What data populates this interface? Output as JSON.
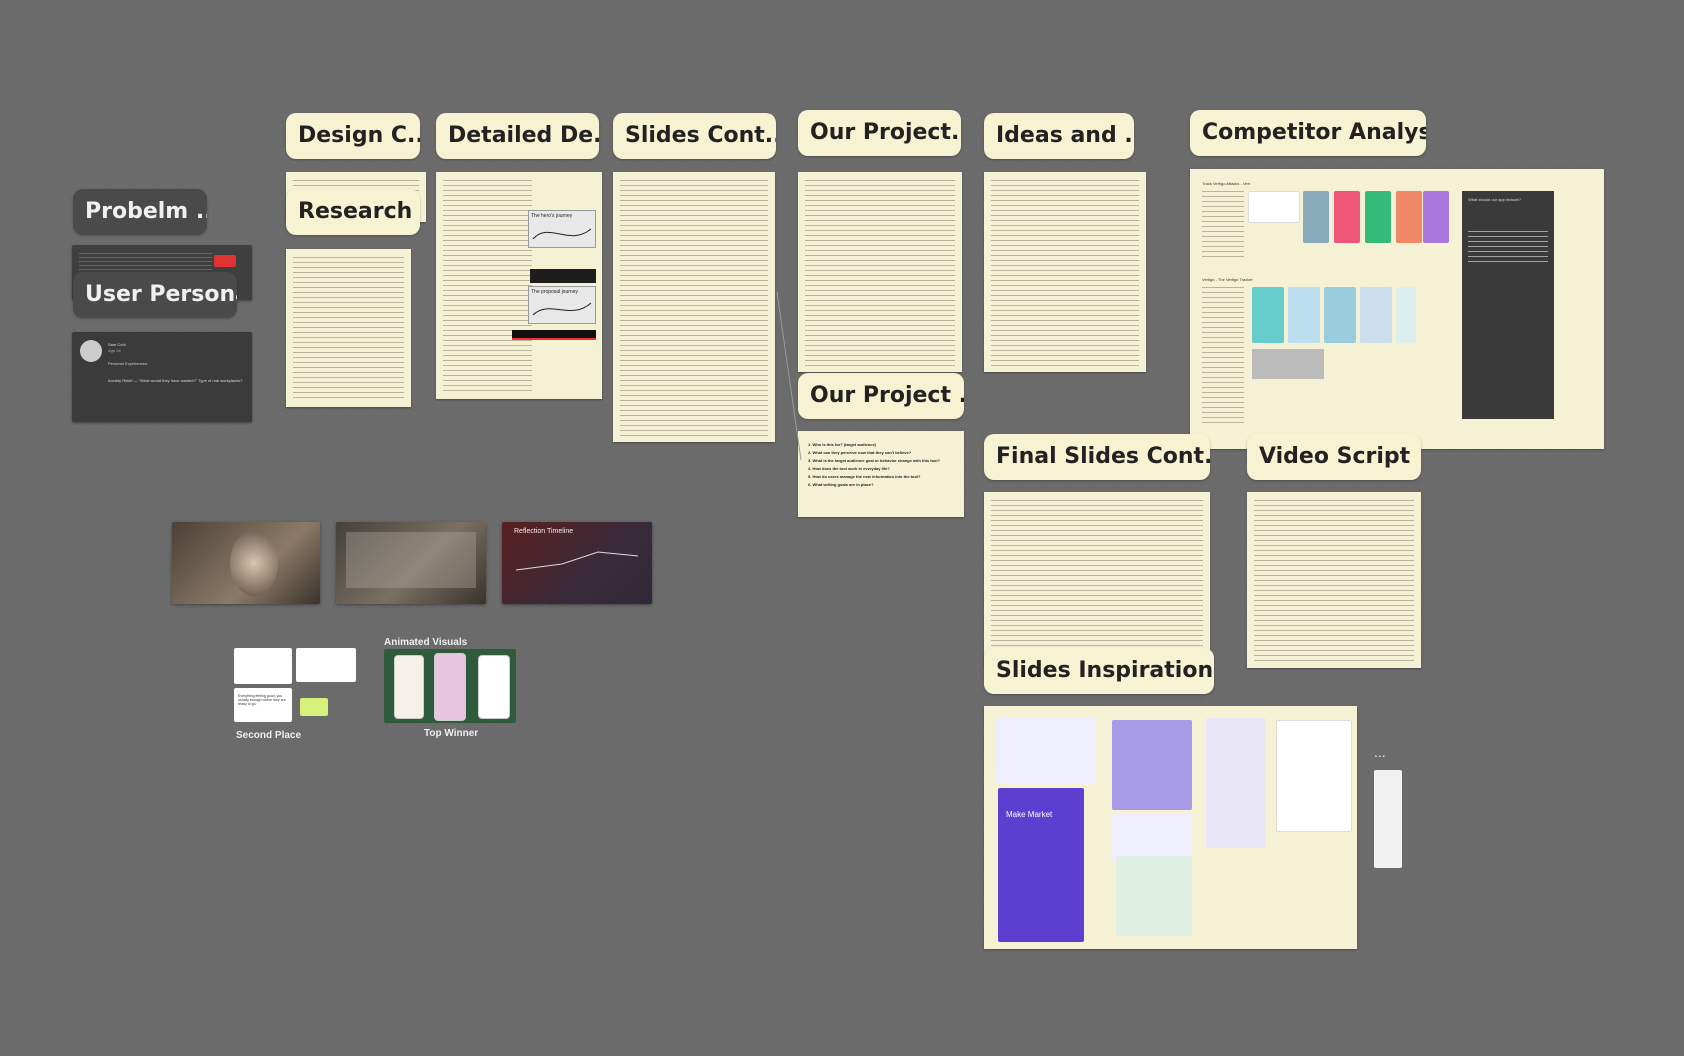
{
  "cards": {
    "design_c": "Design C...",
    "detailed_de": "Detailed De...",
    "slides_cont": "Slides Cont...",
    "our_project_1": "Our Project...",
    "ideas_and": "Ideas and ...",
    "competitor_analysis": "Competitor Analysis",
    "problem": "Probelm ...",
    "research": "Research",
    "user_persona": "User Persona",
    "our_project_2": "Our Project ...",
    "final_slides_cont": "Final Slides Cont...",
    "video_script": "Video Script",
    "slides_inspiration": "Slides Inspiration"
  },
  "doc_text": {
    "slides_reflection_title": "Reflection Timeline",
    "hero_journey": "The hero's journey",
    "proposal_journey": "The proposal journey",
    "competitor_track": "Track Vertigo Attacks - Vert",
    "competitor_vertigo": "Vertigo - The Vertigo Tracker",
    "competitor_question": "What should our app include?",
    "our_project_questions": [
      "1. Who is this for? (target audience)",
      "2. What can they perceive now that they can't believe?",
      "3. What is the target audience goal or behavior change with this tool?",
      "4. How does the tool work in everyday life?",
      "5. How do users manage the new information into the tool?",
      "6. What writing goals are in place?"
    ],
    "persona_name": "Sam Cohl",
    "persona_age": "Age 26",
    "persona_label": "Personal Experiences:",
    "persona_quote": "Anxiety Relief — \"What would they have wanted?\" Type of real workplaces?"
  },
  "gallery": {
    "animated_visuals": "Animated Visuals",
    "top_winner": "Top Winner",
    "second_place": "Second Place",
    "second_place_note": "Everything feeling good, you usually enough where they are ready to go.",
    "make_market": "Make Market"
  },
  "overflow_more": "..."
}
